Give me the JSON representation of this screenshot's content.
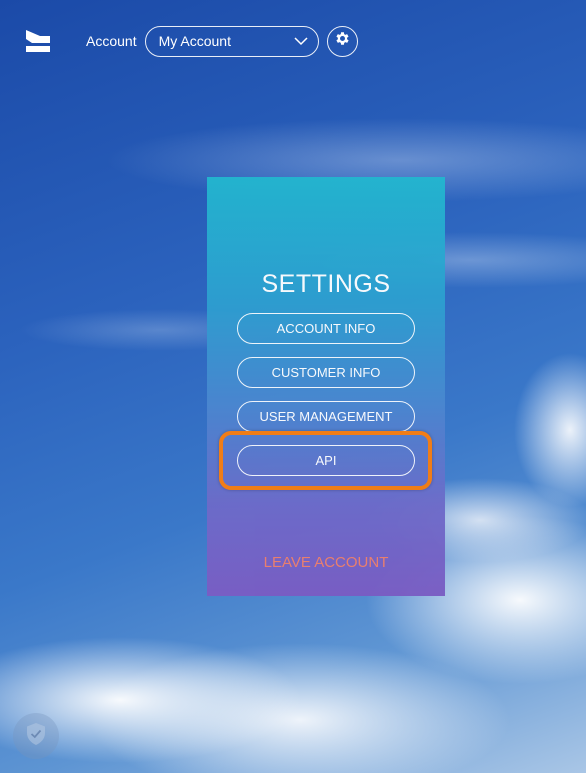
{
  "header": {
    "account_label": "Account",
    "account_select": {
      "selected": "My Account"
    },
    "icons": {
      "logo": "app-logo",
      "select_caret": "chevron-down-icon",
      "settings": "gear-icon"
    }
  },
  "settings_panel": {
    "title": "SETTINGS",
    "items": [
      {
        "label": "ACCOUNT INFO"
      },
      {
        "label": "CUSTOMER INFO"
      },
      {
        "label": "USER MANAGEMENT"
      },
      {
        "label": "API"
      }
    ],
    "highlighted_item": "API",
    "leave_label": "LEAVE ACCOUNT"
  },
  "footer": {
    "shield_icon": "shield-check-icon"
  },
  "colors": {
    "highlight": "#f07d17",
    "leave_text": "#f07f6b",
    "panel_top": "#22b6cf",
    "panel_bottom": "#7a5cc3"
  }
}
